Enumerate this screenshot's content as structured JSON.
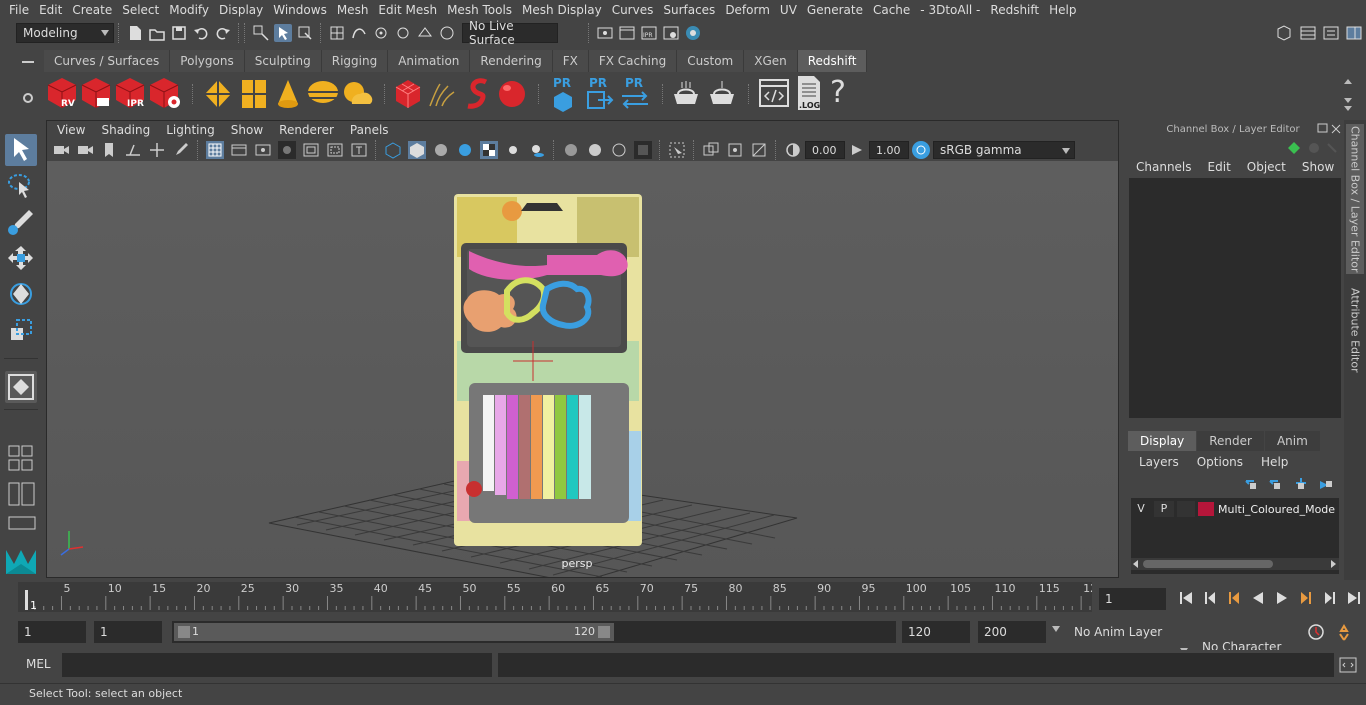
{
  "menubar": [
    "File",
    "Edit",
    "Create",
    "Select",
    "Modify",
    "Display",
    "Windows",
    "Mesh",
    "Edit Mesh",
    "Mesh Tools",
    "Mesh Display",
    "Curves",
    "Surfaces",
    "Deform",
    "UV",
    "Generate",
    "Cache",
    "- 3DtoAll -",
    "Redshift",
    "Help"
  ],
  "status": {
    "workspace": "Modeling",
    "live_surface": "No Live Surface"
  },
  "shelf_tabs": [
    "Curves / Surfaces",
    "Polygons",
    "Sculpting",
    "Rigging",
    "Animation",
    "Rendering",
    "FX",
    "FX Caching",
    "Custom",
    "XGen",
    "Redshift"
  ],
  "shelf_active": "Redshift",
  "shelf_labels": {
    "rv": "RV",
    "ipr": "IPR",
    "pr": "PR",
    "log": ".LOG",
    "help": "?"
  },
  "viewport": {
    "menu": [
      "View",
      "Shading",
      "Lighting",
      "Show",
      "Renderer",
      "Panels"
    ],
    "exposure": "0.00",
    "gamma": "1.00",
    "colorspace": "sRGB gamma",
    "camera": "persp"
  },
  "channelbox": {
    "title": "Channel Box / Layer Editor",
    "menu": [
      "Channels",
      "Edit",
      "Object",
      "Show"
    ],
    "tabs": [
      "Display",
      "Render",
      "Anim"
    ],
    "layer_menu": [
      "Layers",
      "Options",
      "Help"
    ],
    "layer": {
      "v": "V",
      "p": "P",
      "name": "Multi_Coloured_Mode",
      "color": "#b5163a"
    }
  },
  "sidetabs": [
    "Channel Box / Layer Editor",
    "Attribute Editor"
  ],
  "timeline": {
    "ticks": [
      "5",
      "10",
      "15",
      "20",
      "25",
      "30",
      "35",
      "40",
      "45",
      "50",
      "55",
      "60",
      "65",
      "70",
      "75",
      "80",
      "85",
      "90",
      "95",
      "100",
      "105",
      "110",
      "115",
      "12"
    ],
    "start_label": "1",
    "current_frame": "1"
  },
  "range": {
    "start": "1",
    "start2": "1",
    "slider_start": "1",
    "slider_end": "120",
    "end": "120",
    "max": "200",
    "anim_layer": "No Anim Layer",
    "char_set": "No Character Set"
  },
  "cmdline": {
    "label": "MEL"
  },
  "helpline": "Select Tool: select an object"
}
